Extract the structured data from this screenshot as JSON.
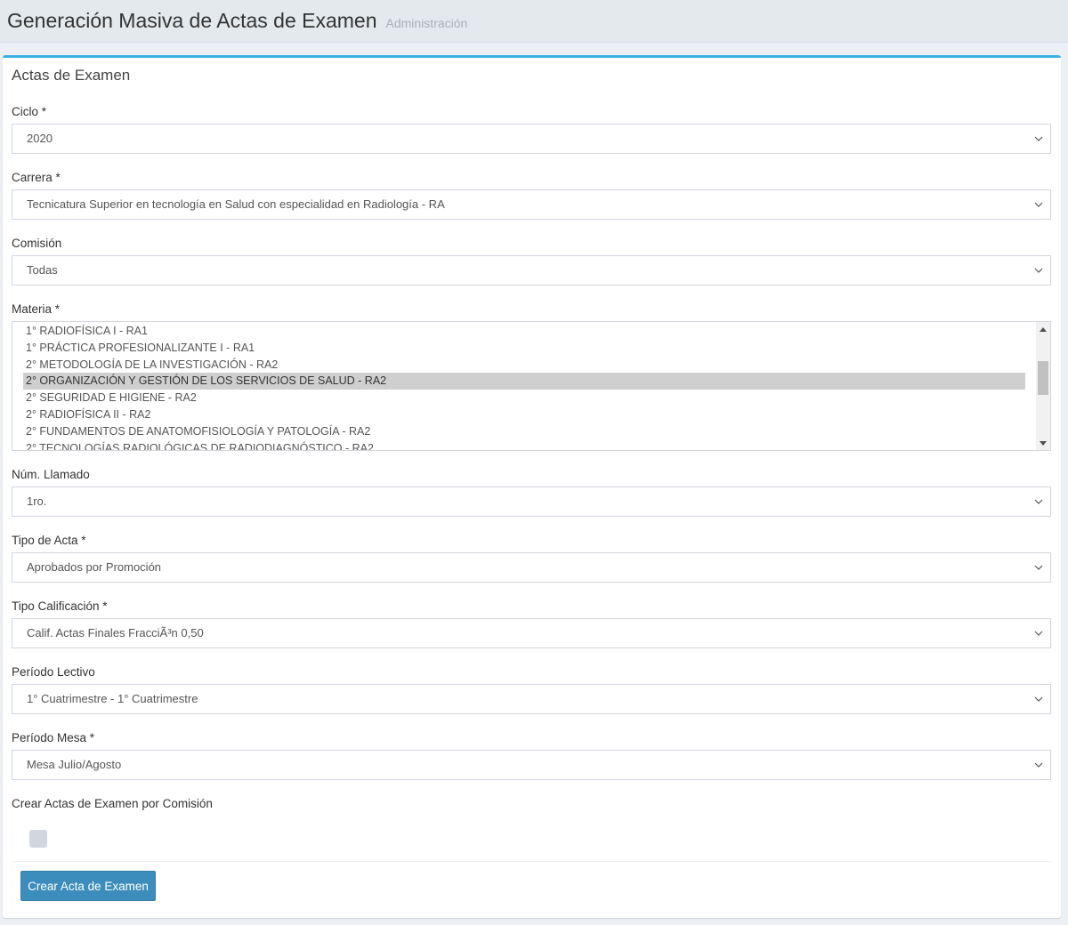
{
  "header": {
    "title": "Generación Masiva de Actas de Examen",
    "subtitle": "Administración"
  },
  "box": {
    "title": "Actas de Examen"
  },
  "fields": {
    "ciclo": {
      "label": "Ciclo *",
      "value": "2020"
    },
    "carrera": {
      "label": "Carrera *",
      "value": "Tecnicatura Superior en tecnología en Salud con especialidad en Radiología - RA"
    },
    "comision": {
      "label": "Comisión",
      "value": "Todas"
    },
    "materia": {
      "label": "Materia *",
      "options": [
        "1° RADIOFÍSICA I - RA1",
        "1° PRÁCTICA PROFESIONALIZANTE I - RA1",
        "2° METODOLOGÍA DE LA INVESTIGACIÓN - RA2",
        "2° ORGANIZACIÓN Y GESTIÓN DE LOS SERVICIOS DE SALUD - RA2",
        "2° SEGURIDAD E HIGIENE - RA2",
        "2° RADIOFÍSICA II - RA2",
        "2° FUNDAMENTOS DE ANATOMOFISIOLOGÍA Y PATOLOGÍA - RA2",
        "2° TECNOLOGÍAS RADIOLÓGICAS DE RADIODIAGNÓSTICO - RA2"
      ],
      "selected_index": 3
    },
    "num_llamado": {
      "label": "Núm. Llamado",
      "value": "1ro."
    },
    "tipo_acta": {
      "label": "Tipo de Acta *",
      "value": "Aprobados por Promoción"
    },
    "tipo_calificacion": {
      "label": "Tipo Calificación *",
      "value": "Calif. Actas Finales FracciÃ³n 0,50"
    },
    "periodo_lectivo": {
      "label": "Período Lectivo",
      "value": "1° Cuatrimestre - 1° Cuatrimestre"
    },
    "periodo_mesa": {
      "label": "Período Mesa *",
      "value": "Mesa Julio/Agosto"
    },
    "crear_por_comision": {
      "label": "Crear Actas de Examen por Comisión",
      "checked": false
    }
  },
  "actions": {
    "submit_label": "Crear Acta de Examen"
  },
  "colors": {
    "accent": "#3ab0e2",
    "button": "#3c8dbc",
    "selected_row": "#cfcfcf"
  }
}
